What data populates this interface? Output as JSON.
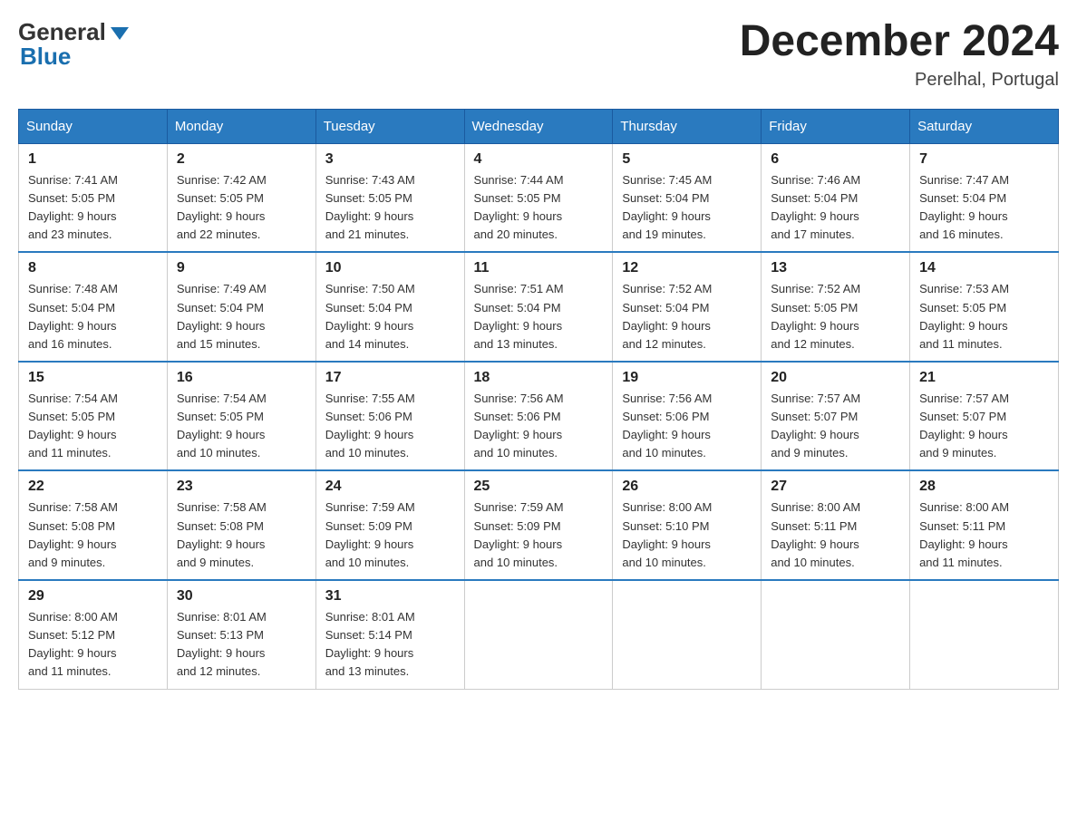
{
  "header": {
    "logo_general": "General",
    "logo_blue": "Blue",
    "month_title": "December 2024",
    "location": "Perelhal, Portugal"
  },
  "days_of_week": [
    "Sunday",
    "Monday",
    "Tuesday",
    "Wednesday",
    "Thursday",
    "Friday",
    "Saturday"
  ],
  "weeks": [
    [
      {
        "day": "1",
        "sunrise": "7:41 AM",
        "sunset": "5:05 PM",
        "daylight": "9 hours and 23 minutes."
      },
      {
        "day": "2",
        "sunrise": "7:42 AM",
        "sunset": "5:05 PM",
        "daylight": "9 hours and 22 minutes."
      },
      {
        "day": "3",
        "sunrise": "7:43 AM",
        "sunset": "5:05 PM",
        "daylight": "9 hours and 21 minutes."
      },
      {
        "day": "4",
        "sunrise": "7:44 AM",
        "sunset": "5:05 PM",
        "daylight": "9 hours and 20 minutes."
      },
      {
        "day": "5",
        "sunrise": "7:45 AM",
        "sunset": "5:04 PM",
        "daylight": "9 hours and 19 minutes."
      },
      {
        "day": "6",
        "sunrise": "7:46 AM",
        "sunset": "5:04 PM",
        "daylight": "9 hours and 17 minutes."
      },
      {
        "day": "7",
        "sunrise": "7:47 AM",
        "sunset": "5:04 PM",
        "daylight": "9 hours and 16 minutes."
      }
    ],
    [
      {
        "day": "8",
        "sunrise": "7:48 AM",
        "sunset": "5:04 PM",
        "daylight": "9 hours and 16 minutes."
      },
      {
        "day": "9",
        "sunrise": "7:49 AM",
        "sunset": "5:04 PM",
        "daylight": "9 hours and 15 minutes."
      },
      {
        "day": "10",
        "sunrise": "7:50 AM",
        "sunset": "5:04 PM",
        "daylight": "9 hours and 14 minutes."
      },
      {
        "day": "11",
        "sunrise": "7:51 AM",
        "sunset": "5:04 PM",
        "daylight": "9 hours and 13 minutes."
      },
      {
        "day": "12",
        "sunrise": "7:52 AM",
        "sunset": "5:04 PM",
        "daylight": "9 hours and 12 minutes."
      },
      {
        "day": "13",
        "sunrise": "7:52 AM",
        "sunset": "5:05 PM",
        "daylight": "9 hours and 12 minutes."
      },
      {
        "day": "14",
        "sunrise": "7:53 AM",
        "sunset": "5:05 PM",
        "daylight": "9 hours and 11 minutes."
      }
    ],
    [
      {
        "day": "15",
        "sunrise": "7:54 AM",
        "sunset": "5:05 PM",
        "daylight": "9 hours and 11 minutes."
      },
      {
        "day": "16",
        "sunrise": "7:54 AM",
        "sunset": "5:05 PM",
        "daylight": "9 hours and 10 minutes."
      },
      {
        "day": "17",
        "sunrise": "7:55 AM",
        "sunset": "5:06 PM",
        "daylight": "9 hours and 10 minutes."
      },
      {
        "day": "18",
        "sunrise": "7:56 AM",
        "sunset": "5:06 PM",
        "daylight": "9 hours and 10 minutes."
      },
      {
        "day": "19",
        "sunrise": "7:56 AM",
        "sunset": "5:06 PM",
        "daylight": "9 hours and 10 minutes."
      },
      {
        "day": "20",
        "sunrise": "7:57 AM",
        "sunset": "5:07 PM",
        "daylight": "9 hours and 9 minutes."
      },
      {
        "day": "21",
        "sunrise": "7:57 AM",
        "sunset": "5:07 PM",
        "daylight": "9 hours and 9 minutes."
      }
    ],
    [
      {
        "day": "22",
        "sunrise": "7:58 AM",
        "sunset": "5:08 PM",
        "daylight": "9 hours and 9 minutes."
      },
      {
        "day": "23",
        "sunrise": "7:58 AM",
        "sunset": "5:08 PM",
        "daylight": "9 hours and 9 minutes."
      },
      {
        "day": "24",
        "sunrise": "7:59 AM",
        "sunset": "5:09 PM",
        "daylight": "9 hours and 10 minutes."
      },
      {
        "day": "25",
        "sunrise": "7:59 AM",
        "sunset": "5:09 PM",
        "daylight": "9 hours and 10 minutes."
      },
      {
        "day": "26",
        "sunrise": "8:00 AM",
        "sunset": "5:10 PM",
        "daylight": "9 hours and 10 minutes."
      },
      {
        "day": "27",
        "sunrise": "8:00 AM",
        "sunset": "5:11 PM",
        "daylight": "9 hours and 10 minutes."
      },
      {
        "day": "28",
        "sunrise": "8:00 AM",
        "sunset": "5:11 PM",
        "daylight": "9 hours and 11 minutes."
      }
    ],
    [
      {
        "day": "29",
        "sunrise": "8:00 AM",
        "sunset": "5:12 PM",
        "daylight": "9 hours and 11 minutes."
      },
      {
        "day": "30",
        "sunrise": "8:01 AM",
        "sunset": "5:13 PM",
        "daylight": "9 hours and 12 minutes."
      },
      {
        "day": "31",
        "sunrise": "8:01 AM",
        "sunset": "5:14 PM",
        "daylight": "9 hours and 13 minutes."
      },
      null,
      null,
      null,
      null
    ]
  ],
  "labels": {
    "sunrise": "Sunrise:",
    "sunset": "Sunset:",
    "daylight": "Daylight:"
  }
}
